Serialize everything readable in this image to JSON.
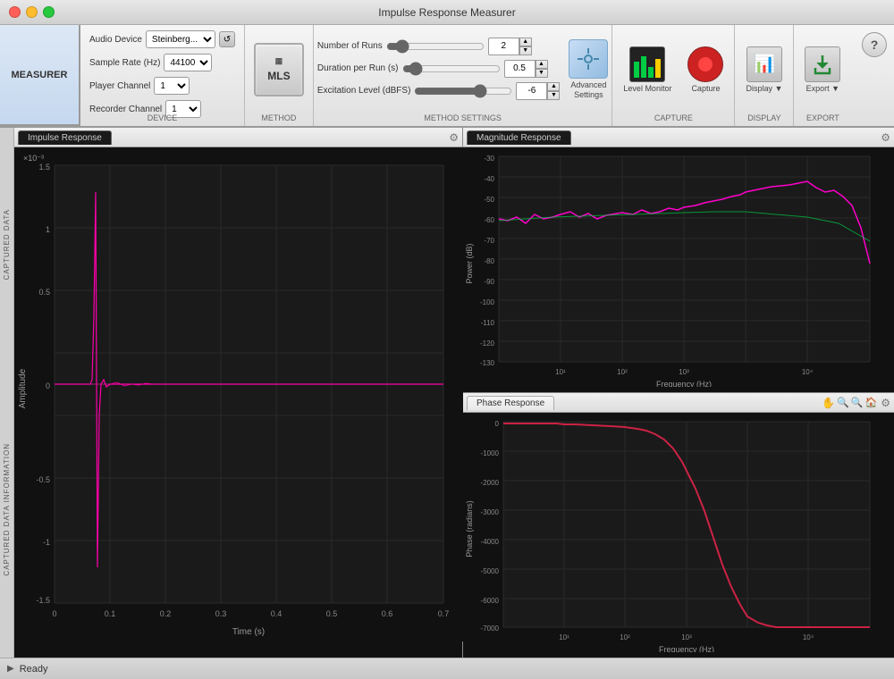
{
  "window": {
    "title": "Impulse Response Measurer"
  },
  "toolbar": {
    "measurer_tab": "MEASURER",
    "help_label": "?",
    "device": {
      "label": "DEVICE",
      "audio_device_label": "Audio Device",
      "audio_device_value": "Steinberg...",
      "sample_rate_label": "Sample Rate (Hz)",
      "sample_rate_value": "44100",
      "player_channel_label": "Player Channel",
      "player_channel_value": "1",
      "recorder_channel_label": "Recorder Channel",
      "recorder_channel_value": "1"
    },
    "method": {
      "label": "METHOD",
      "mls_label": "MLS"
    },
    "method_settings": {
      "label": "METHOD SETTINGS",
      "number_of_runs_label": "Number of Runs",
      "number_of_runs_value": "2",
      "duration_per_run_label": "Duration per Run (s)",
      "duration_per_run_value": "0.5",
      "excitation_level_label": "Excitation Level (dBFS)",
      "excitation_level_value": "-6",
      "advanced_settings_label": "Advanced\nSettings"
    },
    "capture": {
      "label": "CAPTURE",
      "level_monitor_label": "Level\nMonitor",
      "capture_label": "Capture"
    },
    "display": {
      "label": "DISPLAY",
      "display_label": "Display"
    },
    "export": {
      "label": "EXPORT",
      "export_label": "Export"
    }
  },
  "panels": {
    "impulse_response": {
      "tab_label": "Impulse Response",
      "x_axis_label": "Time (s)",
      "y_axis_label": "Amplitude",
      "y_scale": "×10⁻³"
    },
    "magnitude_response": {
      "tab_label": "Magnitude Response",
      "x_axis_label": "Frequency (Hz)",
      "y_axis_label": "Power (dB)"
    },
    "phase_response": {
      "tab_label": "Phase Response",
      "x_axis_label": "Frequency (Hz)",
      "y_axis_label": "Phase (radians)"
    }
  },
  "side_labels": {
    "upper": "CAPTURED DATA",
    "lower": "CAPTURED DATA INFORMATION"
  },
  "status_bar": {
    "text": "Ready"
  }
}
